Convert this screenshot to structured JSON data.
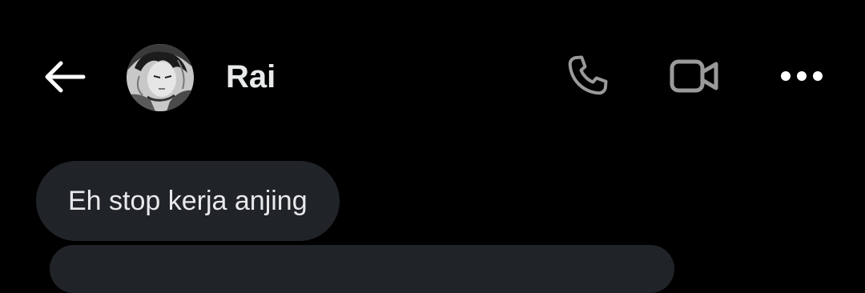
{
  "header": {
    "contact_name": "Rai",
    "back_icon": "arrow-left-icon",
    "call_icon": "phone-icon",
    "video_icon": "video-camera-icon",
    "more_icon": "more-horizontal-icon"
  },
  "messages": [
    {
      "direction": "incoming",
      "text": "Eh stop kerja anjing"
    }
  ],
  "colors": {
    "background": "#000000",
    "bubble": "#202327",
    "text": "#e7e9ea",
    "icon": "#9a9a9a"
  }
}
